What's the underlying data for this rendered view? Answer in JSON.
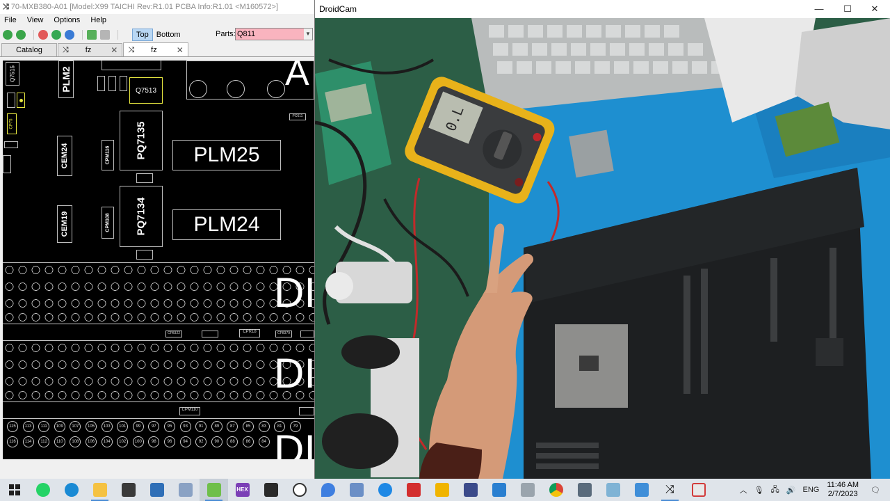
{
  "viewer": {
    "title": "70-MXB380-A01 [Model:X99 TAICHI Rev:R1.01 PCBA Info:R1.01     <M160572>]",
    "menu": [
      "File",
      "View",
      "Options",
      "Help"
    ],
    "toolbar": {
      "top_label": "Top",
      "bottom_label": "Bottom",
      "parts_label": "Parts:",
      "parts_value": "Q811"
    },
    "tabs": [
      {
        "label": "Catalog"
      },
      {
        "label": "fz"
      },
      {
        "label": "fz"
      }
    ],
    "board": {
      "components": [
        "PLM2",
        "Q7515",
        "Q7513",
        "PQ7135",
        "CEM24",
        "CPM116",
        "PLM25",
        "PQ7134",
        "CEM19",
        "CPM108",
        "PLM24",
        "CP75",
        "PC611",
        "CP8322",
        "CPR18",
        "CP8379",
        "CPM110"
      ],
      "big_letters": [
        "A",
        "DI",
        "DI",
        "DI"
      ],
      "pin_row_top": [
        "115",
        "113",
        "111",
        "109",
        "107",
        "105",
        "103",
        "101",
        "99",
        "97",
        "95",
        "93",
        "91",
        "89",
        "87",
        "85",
        "83",
        "81",
        "79"
      ],
      "pin_row_bottom": [
        "116",
        "114",
        "112",
        "110",
        "108",
        "106",
        "104",
        "102",
        "100",
        "98",
        "96",
        "94",
        "92",
        "90",
        "88",
        "86",
        "84"
      ]
    }
  },
  "droidcam": {
    "title": "DroidCam",
    "meter_reading": "0.L"
  },
  "taskbar": {
    "apps": [
      "start-icon",
      "whatsapp-icon",
      "edge-icon",
      "file-explorer-icon",
      "app-icon",
      "app-icon",
      "app-icon",
      "droidcam-icon",
      "hex-app-icon",
      "terminal-icon",
      "app-icon",
      "app-icon",
      "app-icon",
      "app-icon",
      "app-icon",
      "app-icon",
      "app-icon",
      "app-icon",
      "app-icon",
      "chrome-icon",
      "app-icon",
      "app-icon",
      "app-icon",
      "board-viewer-icon",
      "app-icon"
    ],
    "hex_label": "HEX",
    "language": "ENG",
    "time": "11:46 AM",
    "date": "2/7/2023"
  },
  "colors": {
    "parts_highlight": "#f9b4bf",
    "board_bg": "#000000",
    "mat_blue": "#1e8fd0",
    "taskbar": "#dfe4ea"
  }
}
